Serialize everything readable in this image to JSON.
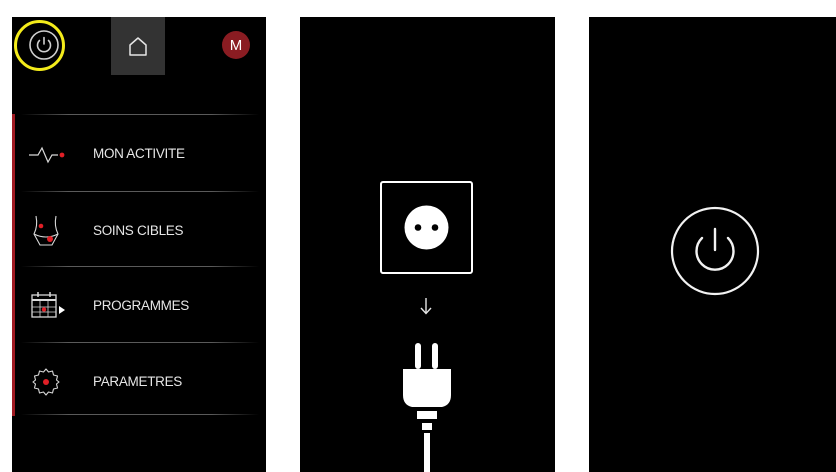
{
  "screen_left": {
    "top_bar": {
      "power_icon": "power-icon",
      "home_icon": "home-icon",
      "avatar_initial": "M"
    },
    "menu": {
      "items": [
        {
          "label": "MON ACTIVITE",
          "icon": "activity-icon"
        },
        {
          "label": "SOINS CIBLES",
          "icon": "body-target-icon"
        },
        {
          "label": "PROGRAMMES",
          "icon": "calendar-icon"
        },
        {
          "label": "PARAMETRES",
          "icon": "gear-icon"
        }
      ]
    }
  },
  "screen_middle": {
    "socket_icon": "power-socket-icon",
    "arrow_icon": "arrow-down-icon",
    "plug_icon": "power-plug-icon"
  },
  "screen_right": {
    "power_icon": "power-icon"
  },
  "colors": {
    "background": "#000000",
    "accent_red": "#a01a22",
    "highlight_yellow": "#f4ec1b",
    "avatar": "#8a1c22",
    "text": "#e6e6e6"
  }
}
